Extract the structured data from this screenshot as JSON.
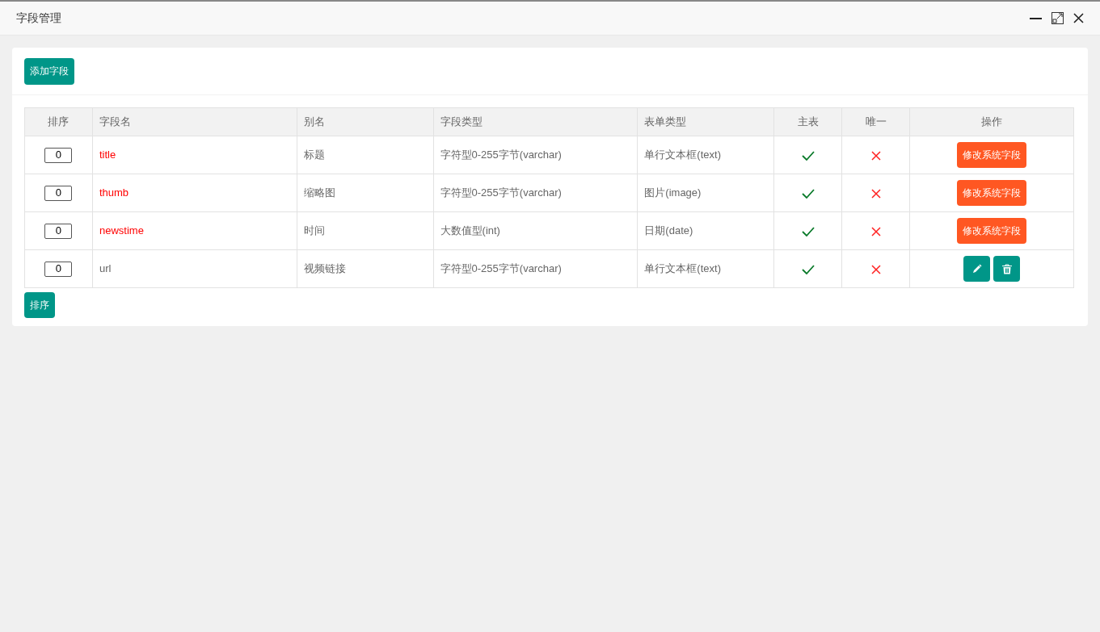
{
  "window": {
    "title": "字段管理"
  },
  "add_button": "添加字段",
  "table": {
    "columns": [
      "排序",
      "字段名",
      "别名",
      "字段类型",
      "表单类型",
      "主表",
      "唯一",
      "操作"
    ],
    "rows": [
      {
        "order": "0",
        "name": "title",
        "alias": "标题",
        "field_type": "字符型0-255字节(varchar)",
        "form_type": "单行文本框(text)",
        "main_table": true,
        "unique": false,
        "system": true,
        "action": "修改系统字段"
      },
      {
        "order": "0",
        "name": "thumb",
        "alias": "缩略图",
        "field_type": "字符型0-255字节(varchar)",
        "form_type": "图片(image)",
        "main_table": true,
        "unique": false,
        "system": true,
        "action": "修改系统字段"
      },
      {
        "order": "0",
        "name": "newstime",
        "alias": "时间",
        "field_type": "大数值型(int)",
        "form_type": "日期(date)",
        "main_table": true,
        "unique": false,
        "system": true,
        "action": "修改系统字段"
      },
      {
        "order": "0",
        "name": "url",
        "alias": "视频链接",
        "field_type": "字符型0-255字节(varchar)",
        "form_type": "单行文本框(text)",
        "main_table": true,
        "unique": false,
        "system": false
      }
    ]
  },
  "sort_button": "排序"
}
